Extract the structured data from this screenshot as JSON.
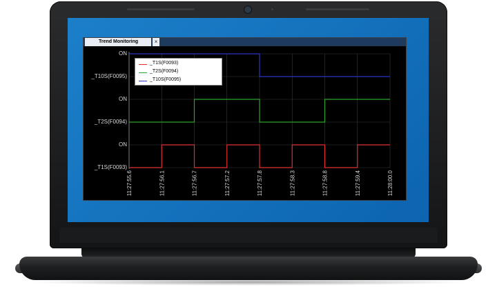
{
  "window": {
    "tab_title": "Trend Monitoring",
    "close_glyph": "×"
  },
  "chart_data": {
    "type": "line",
    "y_labels": [
      "ON",
      "_T10S(F0095)",
      "ON",
      "_T2S(F0094)",
      "ON",
      "_T1S(F0093)"
    ],
    "x_ticks": [
      "11:27:55.6",
      "11:27:56.1",
      "11:27:56.7",
      "11:27:57.2",
      "11:27:57.8",
      "11:27:58.3",
      "11:27:58.8",
      "11:27:59.4",
      "11:28:00.0"
    ],
    "series": [
      {
        "name": "_T1S(F0093)",
        "color": "#e03030",
        "steps": [
          [
            0,
            0
          ],
          [
            1,
            0
          ],
          [
            1,
            1
          ],
          [
            2,
            1
          ],
          [
            2,
            0
          ],
          [
            3,
            0
          ],
          [
            3,
            1
          ],
          [
            4,
            1
          ],
          [
            4,
            0
          ],
          [
            5,
            0
          ],
          [
            5,
            1
          ],
          [
            6,
            1
          ],
          [
            6,
            0
          ],
          [
            7,
            0
          ],
          [
            7,
            1
          ],
          [
            8,
            1
          ]
        ]
      },
      {
        "name": "_T2S(F0094)",
        "color": "#2aa52a",
        "steps": [
          [
            0,
            0
          ],
          [
            2,
            0
          ],
          [
            2,
            1
          ],
          [
            4,
            1
          ],
          [
            4,
            0
          ],
          [
            6,
            0
          ],
          [
            6,
            1
          ],
          [
            8,
            1
          ]
        ]
      },
      {
        "name": "_T10S(F0095)",
        "color": "#2a35c8",
        "steps": [
          [
            0,
            1
          ],
          [
            4,
            1
          ],
          [
            4,
            0
          ],
          [
            8,
            0
          ]
        ]
      }
    ]
  },
  "legend": {
    "items": [
      {
        "label": "_T1S(F0093)",
        "color": "#e03030"
      },
      {
        "label": "_T2S(F0094)",
        "color": "#2aa52a"
      },
      {
        "label": "_T10S(F0095)",
        "color": "#2a35c8"
      }
    ]
  }
}
